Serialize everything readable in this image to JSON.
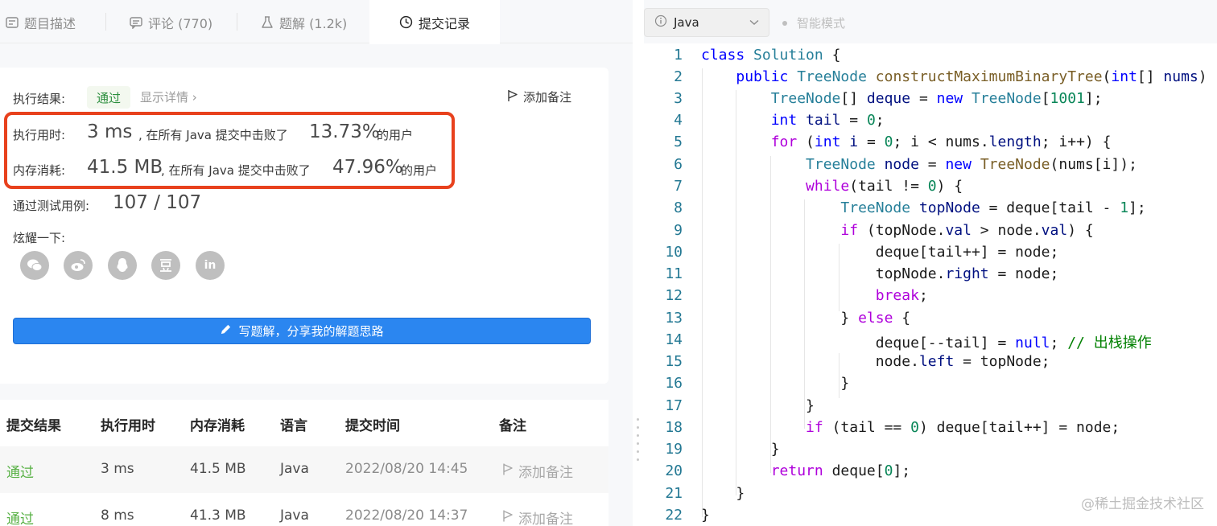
{
  "tabs": [
    {
      "label": "题目描述",
      "icon": "description-icon"
    },
    {
      "label": "评论 (770)",
      "icon": "comment-icon"
    },
    {
      "label": "题解 (1.2k)",
      "icon": "flask-icon"
    },
    {
      "label": "提交记录",
      "icon": "clock-icon"
    }
  ],
  "result": {
    "label": "执行结果:",
    "status": "通过",
    "detail_link": "显示详情 ›",
    "add_note": "添加备注"
  },
  "runtime": {
    "label": "执行用时:",
    "value": "3 ms",
    "text": ", 在所有 Java 提交中击败了",
    "percent": "13.73%",
    "suffix": "的用户"
  },
  "memory": {
    "label": "内存消耗:",
    "value": "41.5 MB",
    "text": ", 在所有 Java 提交中击败了",
    "percent": "47.96%",
    "suffix": "的用户"
  },
  "tests": {
    "label": "通过测试用例:",
    "value": "107 / 107"
  },
  "share": {
    "label": "炫耀一下:",
    "icons": [
      "wechat-icon",
      "weibo-icon",
      "qq-icon",
      "douban-icon",
      "linkedin-icon"
    ]
  },
  "write_button": "写题解，分享我的解题思路",
  "table": {
    "headers": [
      "提交结果",
      "执行用时",
      "内存消耗",
      "语言",
      "提交时间",
      "备注"
    ],
    "rows": [
      {
        "result": "通过",
        "runtime": "3 ms",
        "memory": "41.5 MB",
        "lang": "Java",
        "time": "2022/08/20 14:45",
        "note": "添加备注"
      },
      {
        "result": "通过",
        "runtime": "8 ms",
        "memory": "41.3 MB",
        "lang": "Java",
        "time": "2022/08/20 14:37",
        "note": "添加备注"
      }
    ]
  },
  "editor": {
    "language": "Java",
    "mode": "智能模式",
    "line_numbers": [
      "1",
      "2",
      "3",
      "4",
      "5",
      "6",
      "7",
      "8",
      "9",
      "10",
      "11",
      "12",
      "13",
      "14",
      "15",
      "16",
      "17",
      "18",
      "19",
      "20",
      "21",
      "22"
    ]
  },
  "watermark": "@稀土掘金技术社区",
  "colors": {
    "accent_blue": "#2b86f0",
    "success_green": "#58b145",
    "highlight_red": "#e8411d"
  }
}
